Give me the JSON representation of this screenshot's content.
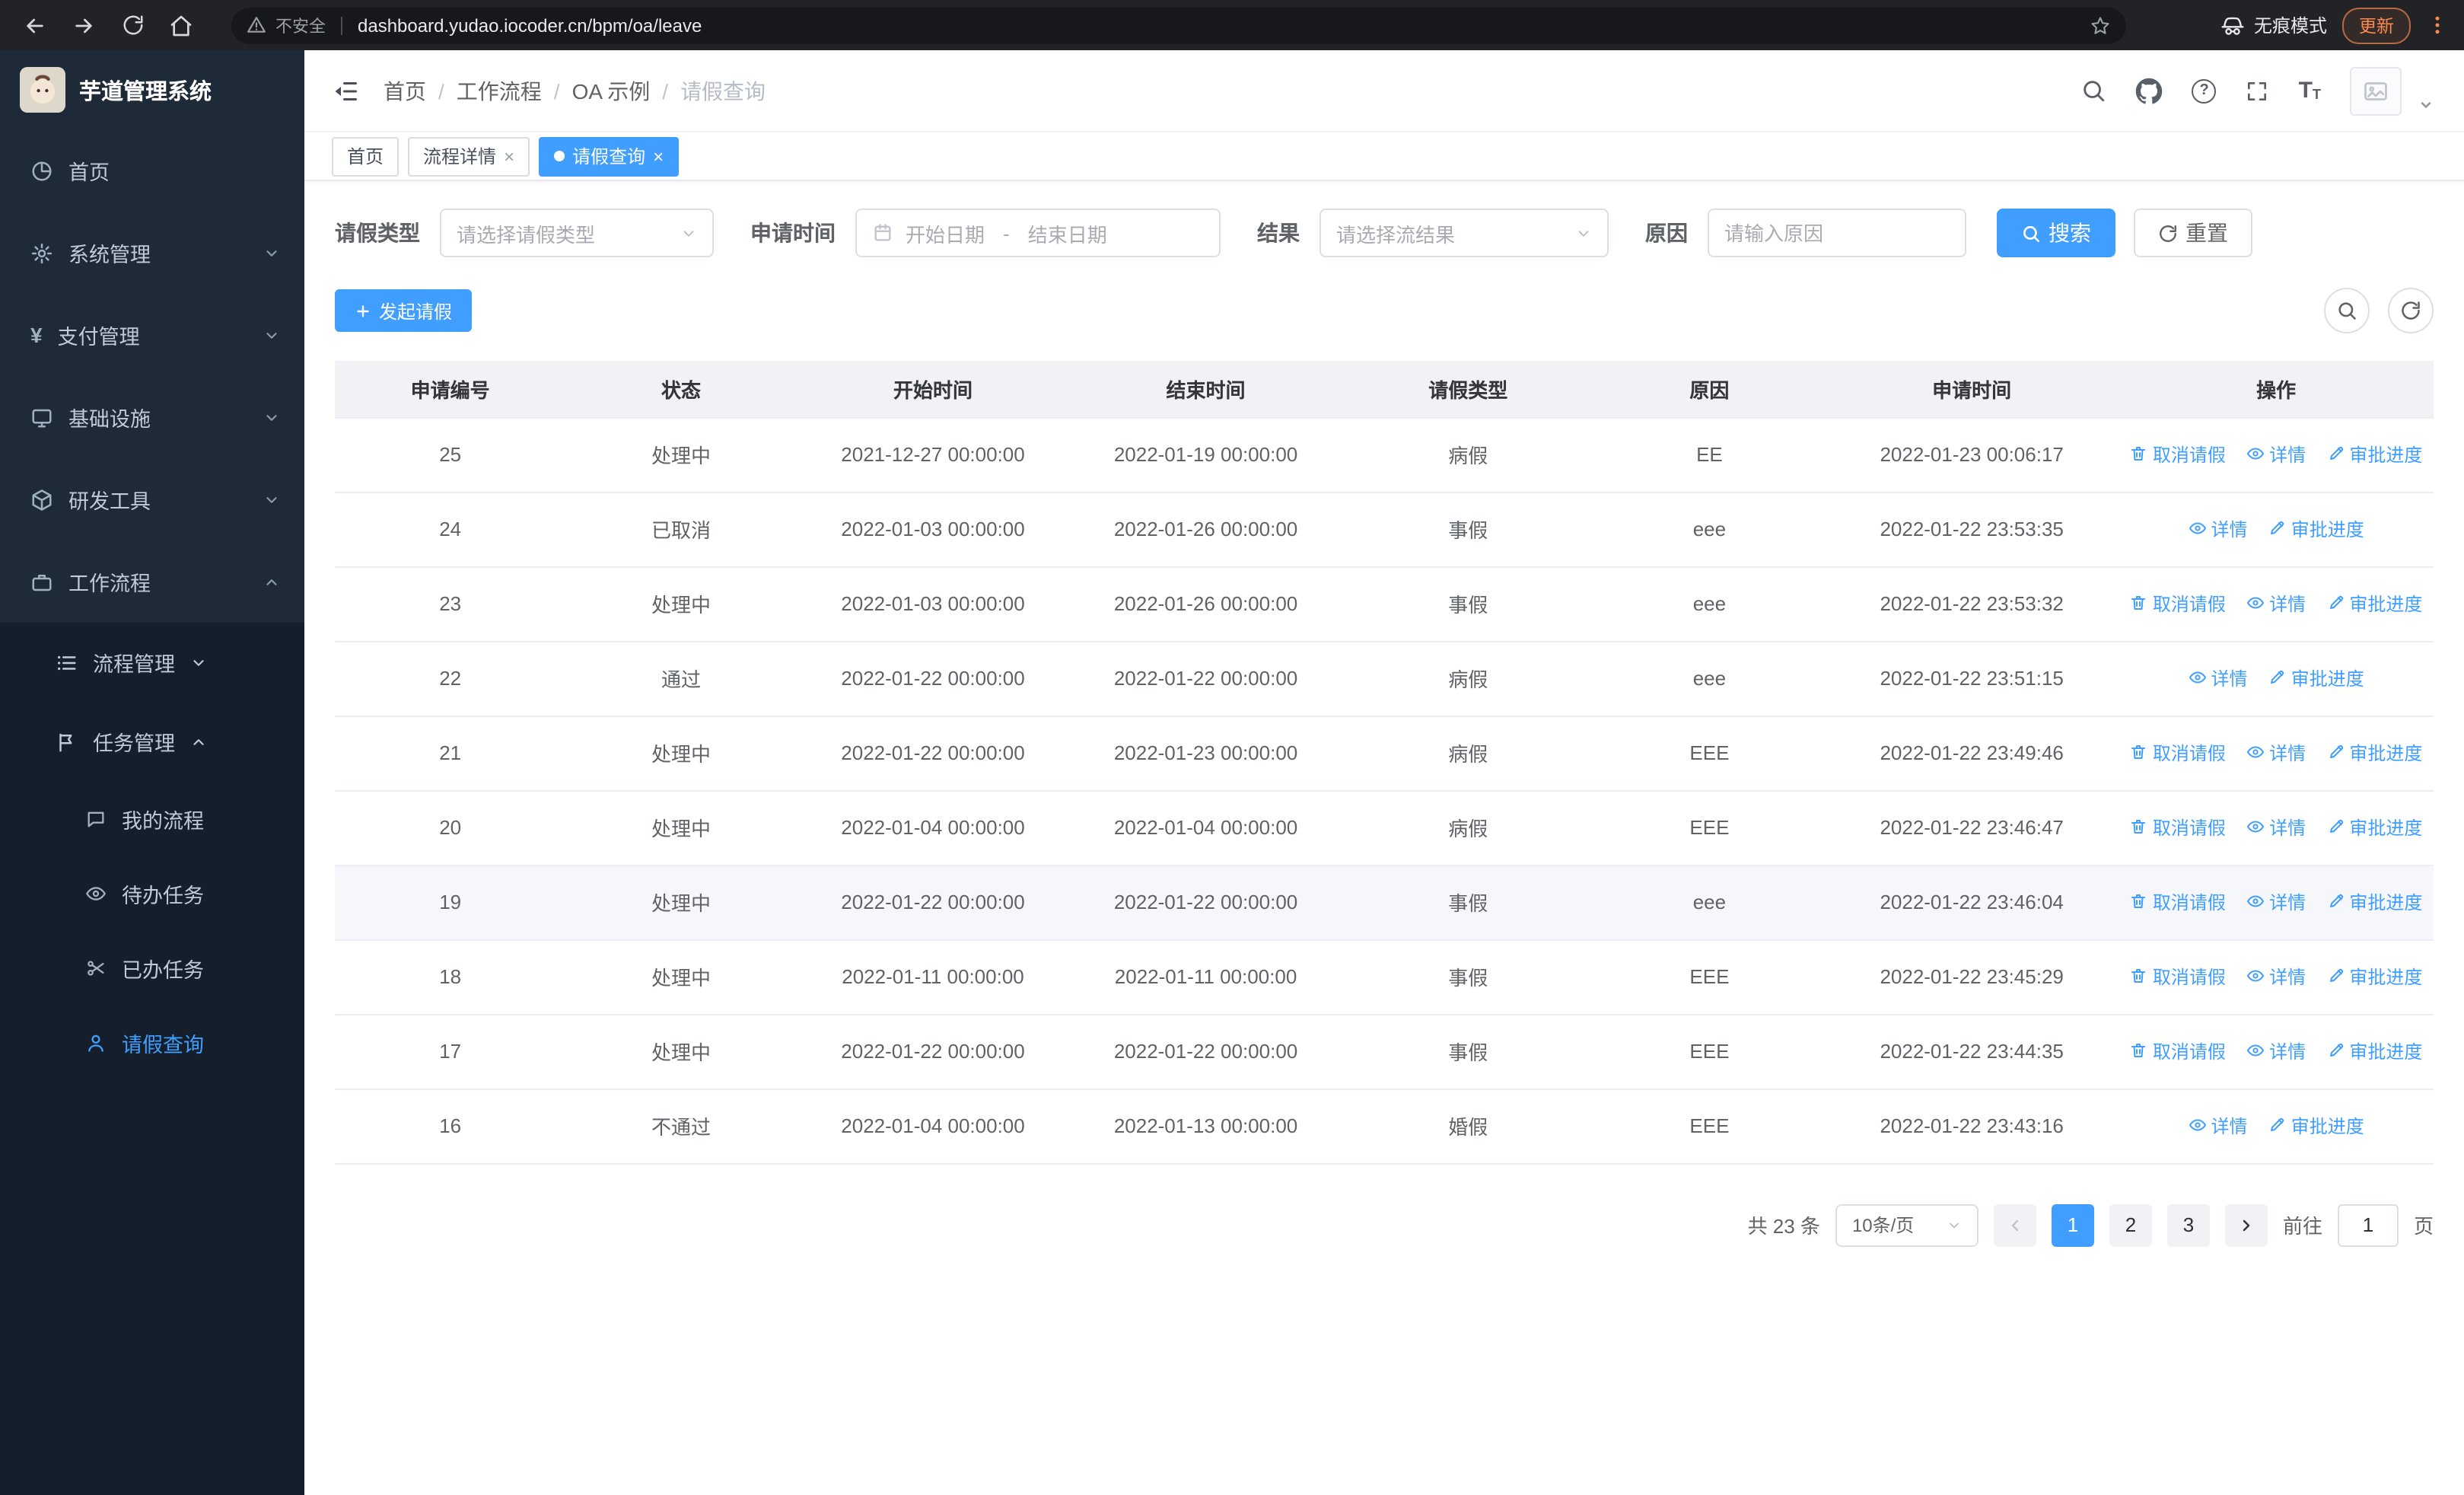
{
  "colors": {
    "primary": "#409eff",
    "sidebar_bg": "#1e2a38",
    "update_accent": "#ff8a50"
  },
  "browser": {
    "security_label": "不安全",
    "url": "dashboard.yudao.iocoder.cn/bpm/oa/leave",
    "incognito_label": "无痕模式",
    "update_label": "更新"
  },
  "sidebar": {
    "logo_title": "芋道管理系统",
    "top_items": [
      "首页",
      "系统管理",
      "支付管理",
      "基础设施",
      "研发工具",
      "工作流程"
    ],
    "group_items": [
      "流程管理",
      "任务管理"
    ],
    "leaf_items": [
      "我的流程",
      "待办任务",
      "已办任务",
      "请假查询"
    ]
  },
  "header": {
    "breadcrumb": [
      "首页",
      "工作流程",
      "OA 示例",
      "请假查询"
    ]
  },
  "tabs": [
    {
      "label": "首页"
    },
    {
      "label": "流程详情"
    },
    {
      "label": "请假查询"
    }
  ],
  "filters": {
    "leave_type": {
      "label": "请假类型",
      "placeholder": "请选择请假类型"
    },
    "apply_time": {
      "label": "申请时间",
      "start_placeholder": "开始日期",
      "separator": "-",
      "end_placeholder": "结束日期"
    },
    "result": {
      "label": "结果",
      "placeholder": "请选择流结果"
    },
    "reason": {
      "label": "原因",
      "placeholder": "请输入原因"
    },
    "search_label": "搜索",
    "reset_label": "重置"
  },
  "toolbar": {
    "create_label": "发起请假"
  },
  "table": {
    "columns": [
      "申请编号",
      "状态",
      "开始时间",
      "结束时间",
      "请假类型",
      "原因",
      "申请时间",
      "操作"
    ],
    "action_labels": {
      "cancel": "取消请假",
      "detail": "详情",
      "progress": "审批进度"
    },
    "rows": [
      {
        "id": "25",
        "status": "处理中",
        "start": "2021-12-27 00:00:00",
        "end": "2022-01-19 00:00:00",
        "type": "病假",
        "reason": "EE",
        "apply_time": "2022-01-23 00:06:17",
        "cancellable": true,
        "highlighted": false
      },
      {
        "id": "24",
        "status": "已取消",
        "start": "2022-01-03 00:00:00",
        "end": "2022-01-26 00:00:00",
        "type": "事假",
        "reason": "eee",
        "apply_time": "2022-01-22 23:53:35",
        "cancellable": false,
        "highlighted": false
      },
      {
        "id": "23",
        "status": "处理中",
        "start": "2022-01-03 00:00:00",
        "end": "2022-01-26 00:00:00",
        "type": "事假",
        "reason": "eee",
        "apply_time": "2022-01-22 23:53:32",
        "cancellable": true,
        "highlighted": false
      },
      {
        "id": "22",
        "status": "通过",
        "start": "2022-01-22 00:00:00",
        "end": "2022-01-22 00:00:00",
        "type": "病假",
        "reason": "eee",
        "apply_time": "2022-01-22 23:51:15",
        "cancellable": false,
        "highlighted": false
      },
      {
        "id": "21",
        "status": "处理中",
        "start": "2022-01-22 00:00:00",
        "end": "2022-01-23 00:00:00",
        "type": "病假",
        "reason": "EEE",
        "apply_time": "2022-01-22 23:49:46",
        "cancellable": true,
        "highlighted": false
      },
      {
        "id": "20",
        "status": "处理中",
        "start": "2022-01-04 00:00:00",
        "end": "2022-01-04 00:00:00",
        "type": "病假",
        "reason": "EEE",
        "apply_time": "2022-01-22 23:46:47",
        "cancellable": true,
        "highlighted": false
      },
      {
        "id": "19",
        "status": "处理中",
        "start": "2022-01-22 00:00:00",
        "end": "2022-01-22 00:00:00",
        "type": "事假",
        "reason": "eee",
        "apply_time": "2022-01-22 23:46:04",
        "cancellable": true,
        "highlighted": true
      },
      {
        "id": "18",
        "status": "处理中",
        "start": "2022-01-11 00:00:00",
        "end": "2022-01-11 00:00:00",
        "type": "事假",
        "reason": "EEE",
        "apply_time": "2022-01-22 23:45:29",
        "cancellable": true,
        "highlighted": false
      },
      {
        "id": "17",
        "status": "处理中",
        "start": "2022-01-22 00:00:00",
        "end": "2022-01-22 00:00:00",
        "type": "事假",
        "reason": "EEE",
        "apply_time": "2022-01-22 23:44:35",
        "cancellable": true,
        "highlighted": false
      },
      {
        "id": "16",
        "status": "不通过",
        "start": "2022-01-04 00:00:00",
        "end": "2022-01-13 00:00:00",
        "type": "婚假",
        "reason": "EEE",
        "apply_time": "2022-01-22 23:43:16",
        "cancellable": false,
        "highlighted": false
      }
    ]
  },
  "pagination": {
    "total_label": "共 23 条",
    "size_label": "10条/页",
    "pages": [
      "1",
      "2",
      "3"
    ],
    "active_page": "1",
    "goto_label": "前往",
    "goto_value": "1",
    "page_unit": "页"
  }
}
